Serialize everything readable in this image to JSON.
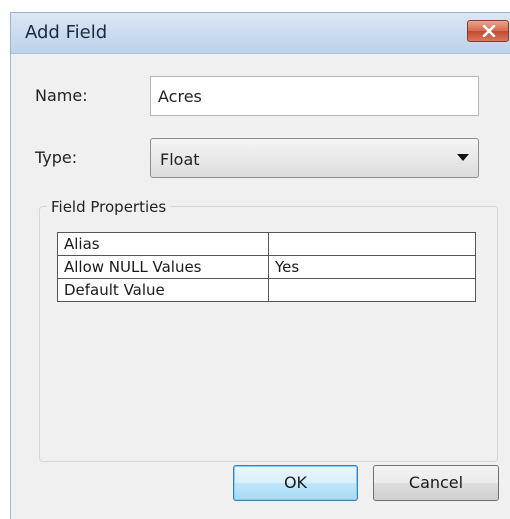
{
  "window": {
    "title": "Add Field"
  },
  "form": {
    "name_label": "Name:",
    "name_value": "Acres",
    "type_label": "Type:",
    "type_value": "Float"
  },
  "field_properties": {
    "title": "Field Properties",
    "rows": [
      {
        "property": "Alias",
        "value": ""
      },
      {
        "property": "Allow NULL Values",
        "value": "Yes"
      },
      {
        "property": "Default Value",
        "value": ""
      }
    ]
  },
  "buttons": {
    "ok_label": "OK",
    "cancel_label": "Cancel"
  },
  "icons": {
    "close": "close-icon",
    "dropdown": "chevron-down-icon"
  },
  "colors": {
    "close_button": "#d56a4f",
    "titlebar": "#c9dbef",
    "ok_border": "#3c7fb1"
  }
}
